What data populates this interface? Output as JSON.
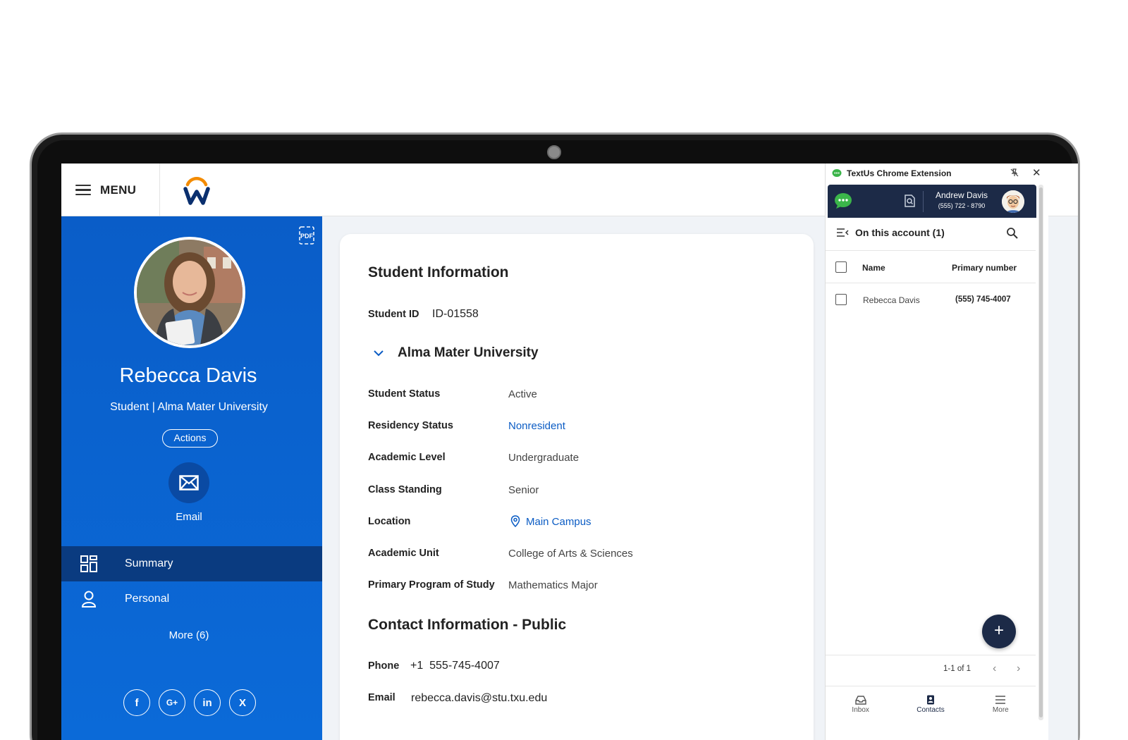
{
  "topbar": {
    "menu_label": "MENU"
  },
  "profile": {
    "name": "Rebecca Davis",
    "subtitle": "Student | Alma Mater University",
    "actions_label": "Actions",
    "email_label": "Email",
    "nav": [
      {
        "label": "Summary",
        "icon": "dashboard-icon",
        "active": true
      },
      {
        "label": "Personal",
        "icon": "person-icon",
        "active": false
      }
    ],
    "more_label": "More (6)",
    "socials": [
      "f",
      "G+",
      "in",
      "X"
    ],
    "pdf_label": "PDF"
  },
  "card": {
    "title": "Student Information",
    "student_id_label": "Student ID",
    "student_id_value": "ID-01558",
    "university": "Alma Mater University",
    "fields": [
      {
        "label": "Student Status",
        "value": "Active"
      },
      {
        "label": "Residency Status",
        "value": "Nonresident"
      },
      {
        "label": "Academic Level",
        "value": "Undergraduate"
      },
      {
        "label": "Class Standing",
        "value": "Senior"
      },
      {
        "label": "Location",
        "value": "Main Campus"
      },
      {
        "label": "Academic Unit",
        "value": "College of Arts & Sciences"
      },
      {
        "label": "Primary Program of Study",
        "value": "Mathematics Major"
      }
    ],
    "contact_title": "Contact Information - Public",
    "phone_label": "Phone",
    "phone_value": "+1  555-745-4007",
    "email_label": "Email",
    "email_value": "rebecca.davis@stu.txu.edu"
  },
  "extension": {
    "title": "TextUs Chrome Extension",
    "user_name": "Andrew Davis",
    "user_phone": "(555) 722 - 8790",
    "account_label": "On this account (1)",
    "columns": {
      "name": "Name",
      "number": "Primary number"
    },
    "rows": [
      {
        "name": "Rebecca Davis",
        "number": "(555) 745-4007"
      }
    ],
    "fab_label": "+",
    "pager": "1-1 of 1",
    "bottom_nav": [
      {
        "label": "Inbox"
      },
      {
        "label": "Contacts"
      },
      {
        "label": "More"
      }
    ]
  },
  "colors": {
    "profile_blue": "#0a5dc8",
    "active_nav": "#0a3b80",
    "link_blue": "#0b5cc4",
    "ext_navy": "#1c2a47"
  }
}
